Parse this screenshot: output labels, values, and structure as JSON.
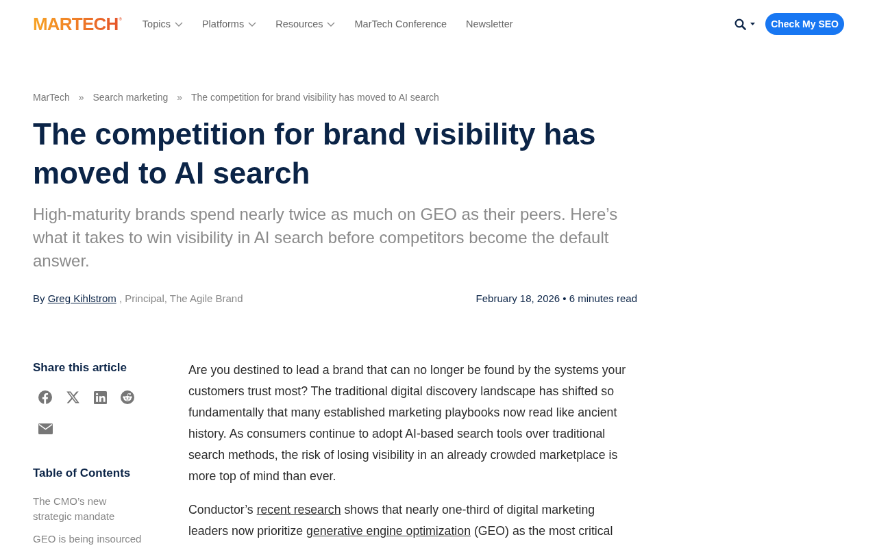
{
  "header": {
    "logo": {
      "text": "MARTECH",
      "mark": "®"
    },
    "nav": [
      {
        "label": "Topics",
        "has_menu": true
      },
      {
        "label": "Platforms",
        "has_menu": true
      },
      {
        "label": "Resources",
        "has_menu": true
      },
      {
        "label": "MarTech Conference",
        "has_menu": false
      },
      {
        "label": "Newsletter",
        "has_menu": false
      }
    ],
    "cta": "Check My SEO"
  },
  "breadcrumb": [
    {
      "label": "MarTech",
      "separator": "»"
    },
    {
      "label": "Search marketing",
      "separator": "»"
    },
    {
      "label": "The competition for brand visibility has moved to AI search"
    }
  ],
  "article": {
    "title": "The competition for brand visibility has moved to AI search",
    "dek": "High-maturity brands spend nearly twice as much on GEO as their peers. Here’s what it takes to win visibility in AI search before competitors become the default answer.",
    "byline": {
      "prefix": "By",
      "author": "Greg Kihlstrom",
      "affiliation": ", Principal, The Agile Brand"
    },
    "meta": "February 18, 2026 • 6 minutes read",
    "paragraphs": [
      [
        {
          "text": "Are you destined to lead a brand that can no longer be found by the systems your customers trust most? The traditional digital discovery landscape has shifted so fundamentally that many established marketing playbooks now read like ancient history. As consumers continue to adopt AI-based search tools over traditional search methods, the risk of losing visibility in an already crowded marketplace is more top of mind than ever."
        }
      ],
      [
        {
          "text": "Conductor’s "
        },
        {
          "text": "recent research",
          "kind": "link"
        },
        {
          "text": " shows that nearly one-third of digital marketing leaders now prioritize "
        },
        {
          "text": "generative engine optimization",
          "kind": "link"
        },
        {
          "text": " (GEO) as the most critical"
        }
      ]
    ]
  },
  "sidebar": {
    "share_title": "Share this article",
    "toc_title": "Table of Contents",
    "toc": [
      "The CMO’s new strategic mandate",
      "GEO is being insourced"
    ]
  }
}
